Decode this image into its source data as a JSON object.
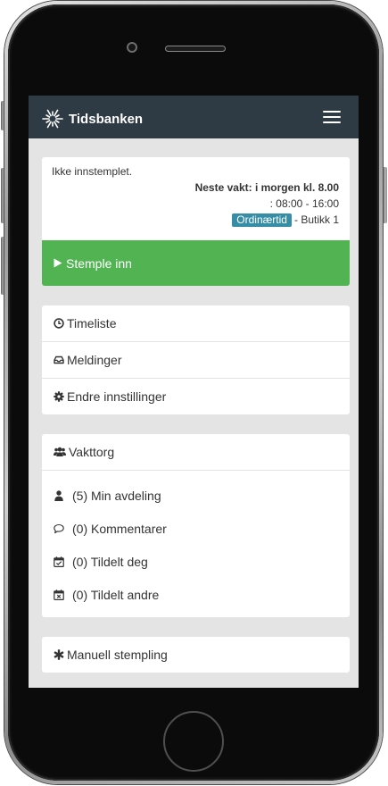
{
  "app": {
    "brand": "Tidsbanken",
    "logo_icon": "tidsbanken-logo-icon",
    "menu_icon": "hamburger-icon"
  },
  "status": {
    "state": "Ikke innstemplet.",
    "next_shift": "Neste vakt: i morgen kl. 8.00",
    "shift_time": ": 08:00 - 16:00",
    "shift_type": "Ordinærtid",
    "shift_location": "- Butikk 1"
  },
  "stamp_button": {
    "label": "Stemple inn",
    "icon": "play-icon"
  },
  "menu": {
    "items": [
      {
        "label": "Timeliste",
        "icon": "clock-icon"
      },
      {
        "label": "Meldinger",
        "icon": "inbox-icon"
      },
      {
        "label": "Endre innstillinger",
        "icon": "gear-icon"
      }
    ]
  },
  "vakttorg": {
    "title": "Vakttorg",
    "icon": "users-icon",
    "items": [
      {
        "label": "(5) Min avdeling",
        "icon": "user-icon"
      },
      {
        "label": "(0) Kommentarer",
        "icon": "comment-icon"
      },
      {
        "label": "(0) Tildelt deg",
        "icon": "calendar-check-icon"
      },
      {
        "label": "(0) Tildelt andre",
        "icon": "calendar-x-icon"
      }
    ]
  },
  "manual_stamping": {
    "label": "Manuell stempling",
    "icon": "asterisk-icon"
  },
  "colors": {
    "header": "#2e3a44",
    "stamp_button": "#52b352",
    "badge": "#358ea6",
    "background": "#e4e4e4"
  }
}
